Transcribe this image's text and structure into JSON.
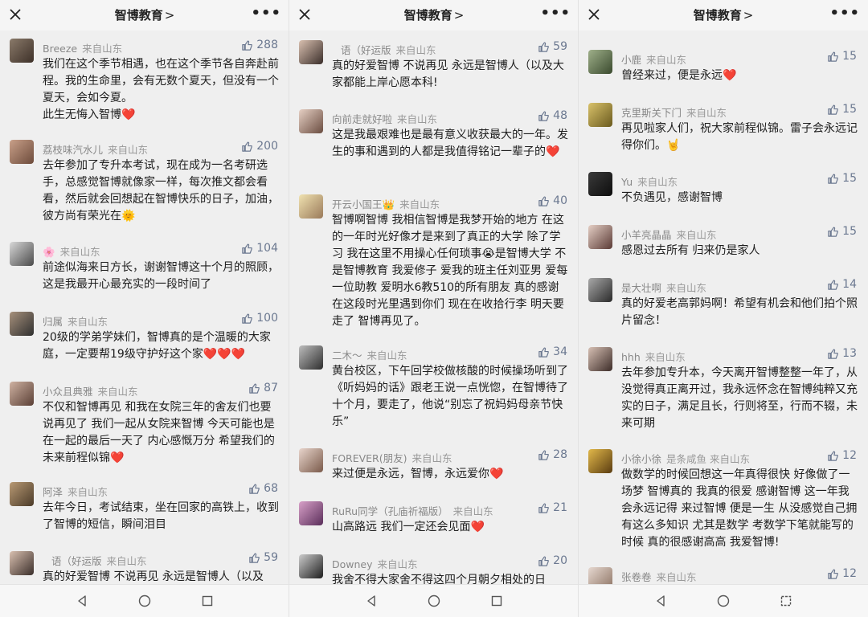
{
  "header": {
    "title": "智博教育",
    "chevron": ">",
    "more": "•••"
  },
  "colors": {
    "heart": "#e8455f",
    "like": "#6b7890",
    "meta": "#888888"
  },
  "panels": [
    {
      "comments": [
        {
          "name": "Breeze",
          "source": "来自山东",
          "likes": "288",
          "text": "我们在这个季节相遇，也在这个季节各自奔赴前程。我的生命里，会有无数个夏天，但没有一个夏天，会如今夏。\n此生无悔入智博",
          "suffix": "❤️"
        },
        {
          "name": "荔枝味汽水儿",
          "source": "来自山东",
          "likes": "200",
          "text": "去年参加了专升本考试，现在成为一名考研选手，总感觉智博就像家一样，每次推文都会看看，然后就会回想起在智博快乐的日子，加油，彼方尚有荣光在",
          "suffix": "🌞"
        },
        {
          "name": "🌸",
          "source": "来自山东",
          "likes": "104",
          "text": "前途似海来日方长，谢谢智博这十个月的照顾，这是我最开心最充实的一段时间了",
          "suffix": ""
        },
        {
          "name": "归属",
          "source": "来自山东",
          "likes": "100",
          "text": "20级的学弟学妹们，智博真的是个温暖的大家庭，一定要帮19级守护好这个家",
          "suffix": "❤️❤️❤️"
        },
        {
          "name": "小众且典雅",
          "source": "来自山东",
          "likes": "87",
          "text": "不仅和智博再见 和我在女院三年的舍友们也要说再见了 我们一起从女院来智博 今天可能也是在一起的最后一天了 内心感慨万分 希望我们的未来前程似锦",
          "suffix": "❤️"
        },
        {
          "name": "阿泽",
          "source": "来自山东",
          "likes": "68",
          "text": "去年今日，考试结束，坐在回家的高铁上，收到了智博的短信，瞬间泪目",
          "suffix": ""
        },
        {
          "name": "语（好运版",
          "source": "来自山东",
          "likes": "59",
          "text": "真的好爱智博 不说再见 永远是智博人（以及",
          "suffix": ""
        }
      ]
    },
    {
      "comments": [
        {
          "name": "语（好运版",
          "source": "来自山东",
          "likes": "59",
          "text": "真的好爱智博 不说再见 永远是智博人（以及大家都能上岸心愿本科!",
          "suffix": ""
        },
        {
          "name": "向前走就好啦",
          "source": "来自山东",
          "likes": "48",
          "text": "这是我最艰难也是最有意义收获最大的一年。发生的事和遇到的人都是我值得铭记一辈子的",
          "suffix": "❤️"
        },
        {
          "name": "开云小国王👑",
          "source": "来自山东",
          "likes": "40",
          "text": "智博啊智博 我相信智博是我梦开始的地方 在这的一年时光好像才是来到了真正的大学 除了学习 我在这里不用操心任何琐事😭是智博大学 不是智博教育 我爱修子 爱我的班主任刘亚男 爱每一位助教 爱明水6教510的所有朋友 真的感谢在这段时光里遇到你们 现在在收拾行李 明天要走了 智博再见了。",
          "suffix": ""
        },
        {
          "name": "二木～",
          "source": "来自山东",
          "likes": "34",
          "text": "黄台校区，下午回学校做核酸的时候操场听到了《听妈妈的话》跟老王说一点恍惚，在智博待了十个月，要走了，他说“别忘了祝妈妈母亲节快乐”",
          "suffix": ""
        },
        {
          "name": "FOREVER(朋友)",
          "source": "来自山东",
          "likes": "28",
          "text": "来过便是永远，智博，永远爱你",
          "suffix": "❤️"
        },
        {
          "name": "RuRu同学（孔庙祈福版）",
          "source": "来自山东",
          "likes": "21",
          "text": "山高路远 我们一定还会见面",
          "suffix": "❤️"
        },
        {
          "name": "Downey",
          "source": "来自山东",
          "likes": "20",
          "text": "我舍不得大家舍不得这四个月朝夕相处的日",
          "suffix": ""
        }
      ]
    },
    {
      "comments": [
        {
          "name": "小鹿",
          "source": "来自山东",
          "likes": "15",
          "text": "曾经来过，便是永远",
          "suffix": "❤️"
        },
        {
          "name": "克里斯关下门",
          "source": "来自山东",
          "likes": "15",
          "text": "再见啦家人们，祝大家前程似锦。雷子会永远记得你们。",
          "suffix": "🤘"
        },
        {
          "name": "Yu",
          "source": "来自山东",
          "likes": "15",
          "text": "不负遇见，感谢智博",
          "suffix": ""
        },
        {
          "name": "小羊亮晶晶",
          "source": "来自山东",
          "likes": "15",
          "text": "感恩过去所有 归来仍是家人",
          "suffix": ""
        },
        {
          "name": "是大壮啊",
          "source": "来自山东",
          "likes": "14",
          "text": "真的好爱老高郭妈啊！希望有机会和他们拍个照片留念！",
          "suffix": ""
        },
        {
          "name": "hhh",
          "source": "来自山东",
          "likes": "13",
          "text": "去年参加专升本，今天离开智博整整一年了，从没觉得真正离开过，我永远怀念在智博纯粹又充实的日子，满足且长，行则将至，行而不辍，未来可期",
          "suffix": ""
        },
        {
          "name": "小徐小徐",
          "source": "是条咸鱼 来自山东",
          "likes": "12",
          "text": "做数学的时候回想这一年真得很快 好像做了一场梦 智博真的 我真的很爱 感谢智博 这一年我会永远记得 来过智博 便是一生 从没感觉自己拥有这么多知识 尤其是数学 考数学下笔就能写的时候 真的很感谢高高 我爱智博!",
          "suffix": ""
        },
        {
          "name": "张卷卷",
          "source": "来自山东",
          "likes": "12",
          "text": "",
          "suffix": ""
        }
      ]
    }
  ]
}
